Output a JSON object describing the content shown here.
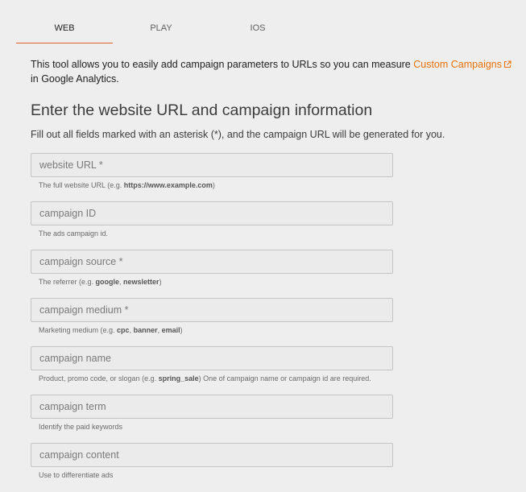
{
  "tabs": [
    {
      "label": "WEB",
      "active": true
    },
    {
      "label": "PLAY",
      "active": false
    },
    {
      "label": "IOS",
      "active": false
    }
  ],
  "accent_color": "#e8710a",
  "intro": {
    "text_before": "This tool allows you to easily add campaign parameters to URLs so you can measure ",
    "link_text": "Custom Campaigns",
    "link_icon": "external-link-icon",
    "text_after": " in Google Analytics."
  },
  "heading": "Enter the website URL and campaign information",
  "subheading": "Fill out all fields marked with an asterisk (*), and the campaign URL will be generated for you.",
  "fields": [
    {
      "placeholder": "website URL *",
      "value": "",
      "help_pre": "The full website URL (e.g. ",
      "help_bold": "https://www.example.com",
      "help_post": ")"
    },
    {
      "placeholder": "campaign ID",
      "value": "",
      "help_pre": "The ads campaign id.",
      "help_bold": "",
      "help_post": ""
    },
    {
      "placeholder": "campaign source *",
      "value": "",
      "help_pre": "The referrer (e.g. ",
      "help_bold": "google",
      "help_mid": ", ",
      "help_bold2": "newsletter",
      "help_post": ")"
    },
    {
      "placeholder": "campaign medium *",
      "value": "",
      "help_pre": "Marketing medium (e.g. ",
      "help_bold": "cpc",
      "help_mid": ", ",
      "help_bold2": "banner",
      "help_mid2": ", ",
      "help_bold3": "email",
      "help_post": ")"
    },
    {
      "placeholder": "campaign name",
      "value": "",
      "help_pre": "Product, promo code, or slogan (e.g. ",
      "help_bold": "spring_sale",
      "help_post": ") One of campaign name or campaign id are required."
    },
    {
      "placeholder": "campaign term",
      "value": "",
      "help_pre": "Identify the paid keywords",
      "help_bold": "",
      "help_post": ""
    },
    {
      "placeholder": "campaign content",
      "value": "",
      "help_pre": "Use to differentiate ads",
      "help_bold": "",
      "help_post": ""
    }
  ]
}
